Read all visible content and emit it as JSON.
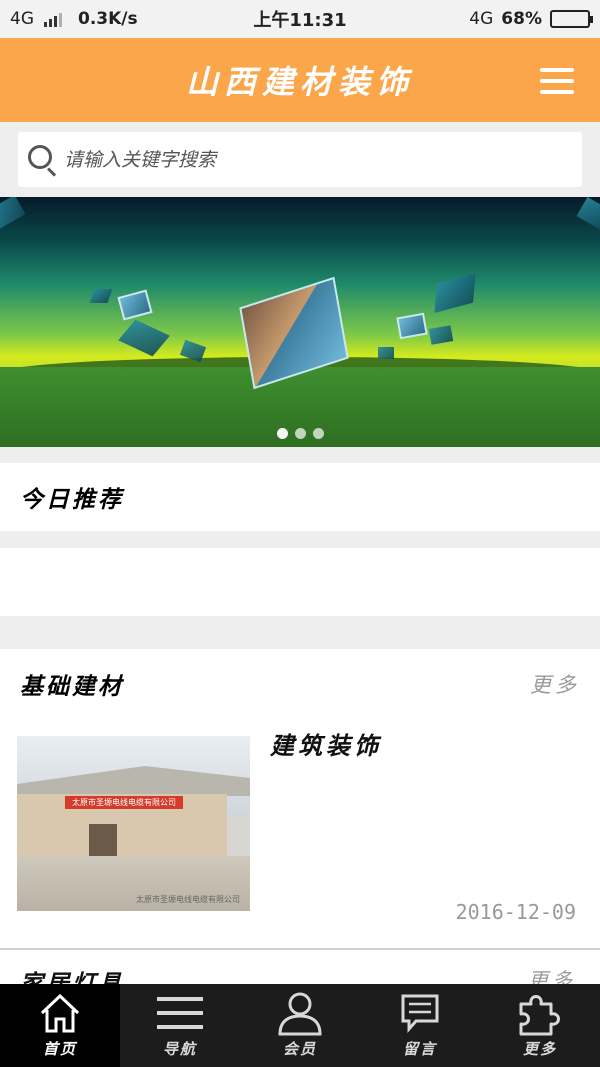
{
  "status_bar": {
    "network": "4G",
    "speed": "0.3K/s",
    "time": "上午11:31",
    "network_right": "4G",
    "battery": "68%",
    "battery_level": 0.68
  },
  "header": {
    "title": "山西建材装饰",
    "menu_icon": "hamburger-menu-icon"
  },
  "search": {
    "placeholder": "请输入关键字搜索",
    "icon": "search-icon"
  },
  "banner": {
    "slide_count": 3,
    "active_slide": 1
  },
  "sections": {
    "today": {
      "title": "今日推荐"
    },
    "basic": {
      "title": "基础建材",
      "more": "更多",
      "article": {
        "title": "建筑装饰",
        "date": "2016-12-09",
        "sign_text": "太原市圣塬电线电缆有限公司",
        "watermark": "太原市圣塬电线电缆有限公司"
      }
    },
    "next": {
      "title": "家居灯具",
      "more": "更多"
    }
  },
  "bottom_nav": [
    {
      "label": "首页",
      "icon": "home-icon",
      "active": true
    },
    {
      "label": "导航",
      "icon": "list-icon",
      "active": false
    },
    {
      "label": "会员",
      "icon": "user-icon",
      "active": false
    },
    {
      "label": "留言",
      "icon": "message-icon",
      "active": false
    },
    {
      "label": "更多",
      "icon": "puzzle-icon",
      "active": false
    }
  ],
  "colors": {
    "header_bg": "#fba64a",
    "nav_bg": "#1c1c1c",
    "muted_text": "#999999"
  }
}
